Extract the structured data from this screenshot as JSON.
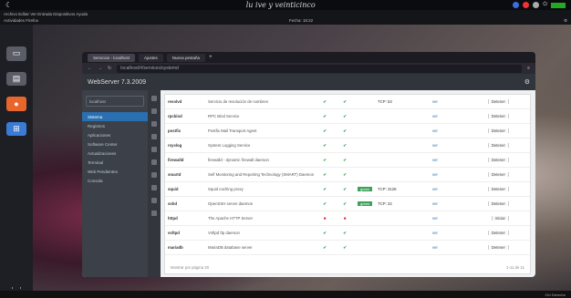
{
  "topbar": {
    "title": "lu ive y veinticinco"
  },
  "menubar": {
    "line1": "Archivo Editar Ver Entrada Dispositivos Ayuda",
    "left": "Actividades  Firefox",
    "center": "Fecha: 18:22"
  },
  "dock": {
    "items": [
      "terminal",
      "files",
      "firefox",
      "software",
      "apps"
    ]
  },
  "browser": {
    "tabs": [
      {
        "label": "Servicios - localhost",
        "active": true
      },
      {
        "label": "Ajustes",
        "active": false
      },
      {
        "label": "Nueva pestaña",
        "active": false
      }
    ],
    "url": "localhost/#/services/systemd"
  },
  "app": {
    "title": "WebServer 7.3.2009",
    "search_placeholder": "localhost",
    "nav": [
      "Sistema",
      "Registros",
      "Aplicaciones",
      "Software Center",
      "Actualizaciones",
      "Terminal",
      "Web Pendientes",
      "Consola"
    ],
    "nav_selected": 0,
    "rows": [
      {
        "name": "resolvd",
        "desc": "Servicio de resolución de nombres",
        "active": true,
        "enabled": true,
        "badge": "",
        "port": "TCP: 53",
        "link": "ver",
        "action": "Detener"
      },
      {
        "name": "rpcbind",
        "desc": "RPC Bind Service",
        "active": true,
        "enabled": true,
        "badge": "",
        "port": "",
        "link": "ver",
        "action": "Detener"
      },
      {
        "name": "postfix",
        "desc": "Postfix Mail Transport Agent",
        "active": true,
        "enabled": true,
        "badge": "",
        "port": "",
        "link": "ver",
        "action": "Detener"
      },
      {
        "name": "rsyslog",
        "desc": "System Logging Service",
        "active": true,
        "enabled": true,
        "badge": "",
        "port": "",
        "link": "ver",
        "action": "Detener"
      },
      {
        "name": "firewalld",
        "desc": "firewalld - dynamic firewall daemon",
        "active": true,
        "enabled": true,
        "badge": "",
        "port": "",
        "link": "ver",
        "action": "Detener"
      },
      {
        "name": "smartd",
        "desc": "Self Monitoring and Reporting Technology (SMART) Daemon",
        "active": true,
        "enabled": true,
        "badge": "",
        "port": "",
        "link": "ver",
        "action": "Detener"
      },
      {
        "name": "squid",
        "desc": "Squid caching proxy",
        "active": true,
        "enabled": true,
        "badge": "green",
        "port": "TCP: 3128",
        "link": "ver",
        "action": "Detener"
      },
      {
        "name": "sshd",
        "desc": "OpenSSH server daemon",
        "active": true,
        "enabled": true,
        "badge": "green",
        "port": "TCP: 22",
        "link": "ver",
        "action": "Detener"
      },
      {
        "name": "httpd",
        "desc": "The Apache HTTP Server",
        "active": false,
        "enabled": false,
        "badge": "",
        "port": "",
        "link": "ver",
        "action": "Iniciar"
      },
      {
        "name": "vsftpd",
        "desc": "Vsftpd ftp daemon",
        "active": true,
        "enabled": true,
        "badge": "",
        "port": "",
        "link": "ver",
        "action": "Detener"
      },
      {
        "name": "mariadb",
        "desc": "MariaDB database server",
        "active": true,
        "enabled": true,
        "badge": "",
        "port": "",
        "link": "ver",
        "action": "Detener"
      }
    ],
    "footer_left": "Mostrar por página 20",
    "footer_right": "1-11 de 11"
  },
  "taskbar": {
    "right": "Ctrl Derecho"
  }
}
